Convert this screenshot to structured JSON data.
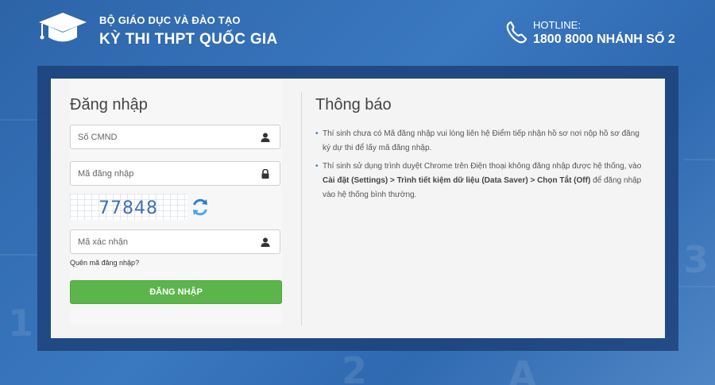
{
  "header": {
    "org_name": "BỘ GIÁO DỤC VÀ ĐÀO TẠO",
    "exam_name": "KỲ THI THPT QUỐC GIA",
    "logo_icon": "graduation-cap-icon",
    "hotline_label": "HOTLINE:",
    "hotline_number": "1800 8000 NHÁNH SỐ 2",
    "phone_icon": "phone-icon"
  },
  "login": {
    "title": "Đăng nhập",
    "id_placeholder": "Số CMND",
    "id_value": "",
    "id_icon": "user-icon",
    "code_placeholder": "Mã đăng nhập",
    "code_value": "",
    "code_icon": "lock-icon",
    "captcha_text": "77848",
    "refresh_icon": "refresh-icon",
    "verify_placeholder": "Mã xác nhận",
    "verify_value": "",
    "verify_icon": "user-icon",
    "forgot_link": "Quên mã đăng nhập?",
    "submit_label": "ĐĂNG NHẬP"
  },
  "notice": {
    "title": "Thông báo",
    "item1": "Thí sinh chưa có Mã đăng nhập vui lòng liên hệ Điểm tiếp nhận hồ sơ nơi nộp hồ sơ đăng ký dự thi để lấy mã đăng nhập.",
    "item2_before": "Thí sinh sử dụng trình duyệt Chrome trên Điện thoại không đăng nhập được hệ thống, vào ",
    "item2_bold": "Cài đặt (Settings) > Trình tiết kiệm dữ liệu (Data Saver) > Chọn Tắt (Off)",
    "item2_after": " để đăng nhập vào hệ thống bình thường."
  },
  "colors": {
    "background": "#3a78bf",
    "panel_frame": "#1c4078",
    "submit_button": "#5cb54a",
    "bullet": "#3a78bf"
  }
}
